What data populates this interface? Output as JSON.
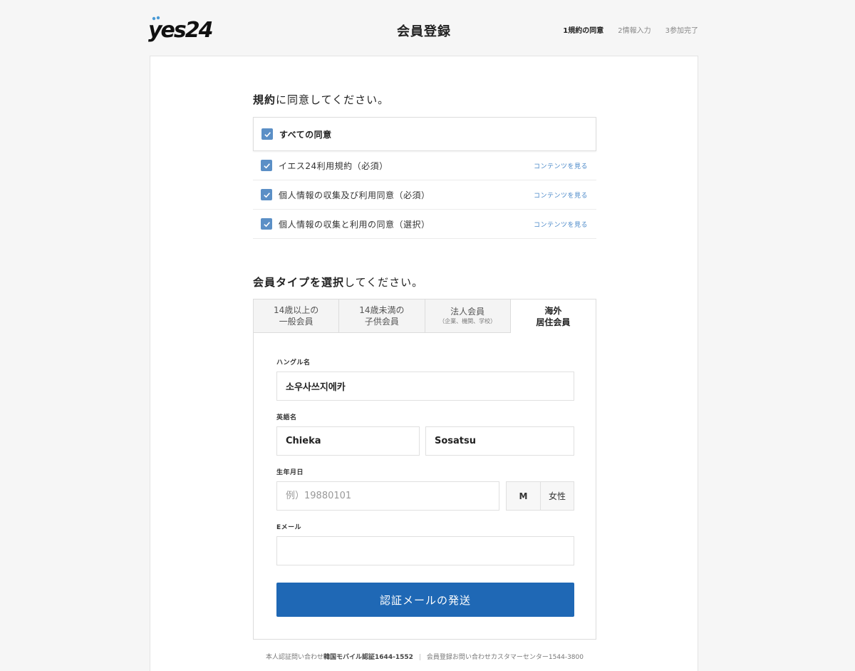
{
  "header": {
    "logo_text": "yes24",
    "title": "会員登録",
    "steps": [
      "1規約の同意",
      "2情報入力",
      "3参加完了"
    ]
  },
  "terms": {
    "heading_bold": "規約",
    "heading_light": "に同意してください。",
    "agree_all": "すべての同意",
    "items": [
      {
        "label": "イエス24利用規約（必須）",
        "link": "コンテンツを見る"
      },
      {
        "label": "個人情報の収集及び利用同意（必須）",
        "link": "コンテンツを見る"
      },
      {
        "label": "個人情報の収集と利用の同意（選択）",
        "link": "コンテンツを見る"
      }
    ]
  },
  "member_type": {
    "heading_bold": "会員タイプを選択",
    "heading_light": "してください。",
    "tabs": [
      {
        "line1": "14歳以上の",
        "line2": "一般会員"
      },
      {
        "line1": "14歳未満の",
        "line2": "子供会員"
      },
      {
        "line1": "法人会員",
        "line2": "（企業、機関、学校）"
      },
      {
        "line1": "海外",
        "line2": "居住会員"
      }
    ]
  },
  "form": {
    "hangul_label": "ハングル名",
    "hangul_value": "소우사쓰지에카",
    "english_label": "英語名",
    "first_name": "Chieka",
    "last_name": "Sosatsu",
    "birth_label": "生年月日",
    "birth_placeholder": "例）19880101",
    "gender_m": "M",
    "gender_f": "女性",
    "email_label": "Eメール",
    "email_value": "",
    "submit": "認証メールの発送"
  },
  "footer": {
    "part1_prefix": "本人認証問い合わせ",
    "part1_bold": "韓国モバイル認証1644-1552",
    "separator": "|",
    "part2": "会員登録お問い合わせカスタマーセンター1544-3800"
  }
}
